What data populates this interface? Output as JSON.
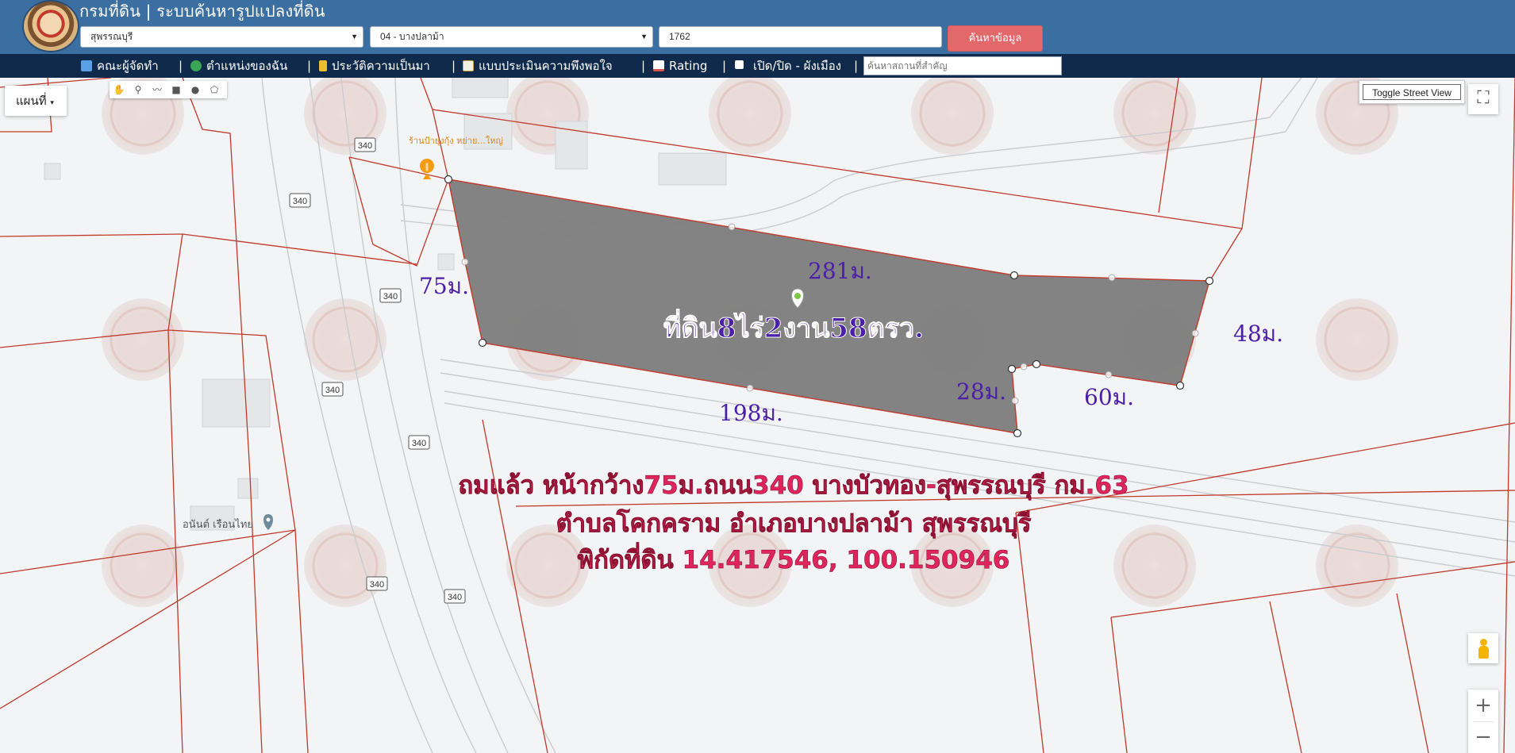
{
  "header": {
    "title": "กรมที่ดิน | ระบบค้นหารูปแปลงที่ดิน",
    "province": "สุพรรณบุรี",
    "district": "04 - บางปลาม้า",
    "parcel_number": "1762",
    "search_button": "ค้นหาข้อมูล"
  },
  "toolbar": {
    "items": [
      {
        "label": "คณะผู้จัดทำ",
        "icon": "team-icon"
      },
      {
        "label": "ตำแหน่งของฉัน",
        "icon": "globe-icon"
      },
      {
        "label": "ประวัติความเป็นมา",
        "icon": "history-icon"
      },
      {
        "label": "แบบประเมินความพึงพอใจ",
        "icon": "survey-icon"
      },
      {
        "label": "Rating",
        "icon": "chart-icon"
      },
      {
        "label": "เปิด/ปิด - ผังเมือง",
        "icon": "checkbox-icon"
      }
    ],
    "separator": "|",
    "place_search_placeholder": "ค้นหาสถานที่สำคัญ"
  },
  "map": {
    "map_type": "แผนที่",
    "street_view_button": "Toggle Street View",
    "fullscreen_icon": "fullscreen-icon",
    "zoom_in": "+",
    "zoom_out": "−",
    "road_shields": [
      "340",
      "340",
      "340",
      "340",
      "340",
      "340",
      "340"
    ],
    "pois": [
      {
        "name": "ร้านป้ายุงกุ้ง หย่าย...ใหญ่",
        "icon": "restaurant-icon"
      },
      {
        "name": "อนันต์ เรือนไทย",
        "icon": "place-pin-icon"
      }
    ],
    "parcel_label": "ที่ดิน8ไร่2งาน58ตรว.",
    "dimensions": [
      "281ม.",
      "75ม.",
      "48ม.",
      "28ม.",
      "60ม.",
      "198ม."
    ],
    "caption": [
      "ถมแล้ว หน้ากว้าง75ม.ถนน340 บางบัวทอง-สุพรรณบุรี กม.63",
      "ตำบลโคกคราม อำเภอบางปลาม้า สุพรรณบุรี",
      "พิกัดที่ดิน 14.417546, 100.150946"
    ],
    "colors": {
      "parcel_fill": "#808080",
      "parcel_border": "#c0392b",
      "dimension_text": "#4b1fa8",
      "caption_text": "#e0245e",
      "header_bg": "#3c6fa1",
      "toolbar_bg": "#0f2a4b"
    }
  }
}
